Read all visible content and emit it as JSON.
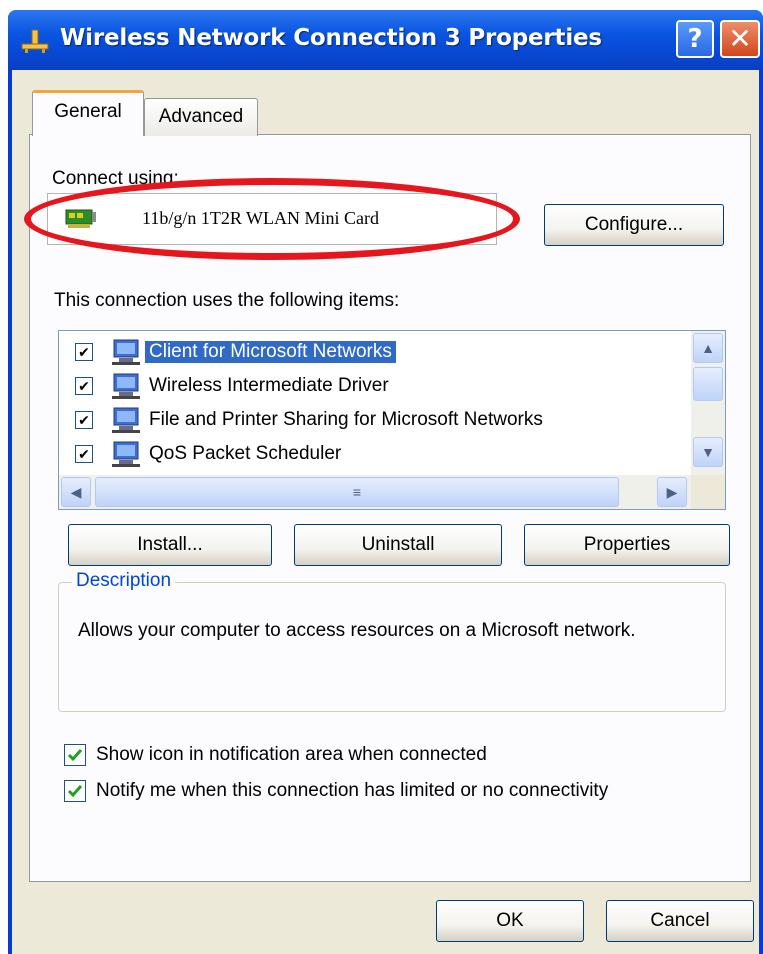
{
  "window": {
    "title": "Wireless Network Connection 3 Properties",
    "help_label": "?",
    "close_label": "✕"
  },
  "tabs": [
    {
      "label": "General",
      "active": true
    },
    {
      "label": "Advanced",
      "active": false
    }
  ],
  "connect_using": {
    "label": "Connect using:",
    "adapter_name": "11b/g/n 1T2R WLAN Mini Card",
    "configure_label": "Configure..."
  },
  "items_section": {
    "label": "This connection uses the following items:",
    "items": [
      {
        "label": "Client for Microsoft Networks",
        "checked": true,
        "selected": true
      },
      {
        "label": "Wireless Intermediate Driver",
        "checked": true,
        "selected": false
      },
      {
        "label": "File and Printer Sharing for Microsoft Networks",
        "checked": true,
        "selected": false
      },
      {
        "label": "QoS Packet Scheduler",
        "checked": true,
        "selected": false
      }
    ]
  },
  "item_buttons": {
    "install": "Install...",
    "uninstall": "Uninstall",
    "properties": "Properties"
  },
  "description": {
    "legend": "Description",
    "text": "Allows your computer to access resources on a Microsoft network."
  },
  "options": {
    "show_icon": {
      "label": "Show icon in notification area when connected",
      "checked": true
    },
    "notify": {
      "label": "Notify me when this connection has limited or no connectivity",
      "checked": true
    }
  },
  "footer": {
    "ok": "OK",
    "cancel": "Cancel"
  },
  "colors": {
    "accent_red": "#e5161d",
    "title_blue": "#0a55e0",
    "selection": "#316ac5",
    "check_green": "#21a121"
  }
}
